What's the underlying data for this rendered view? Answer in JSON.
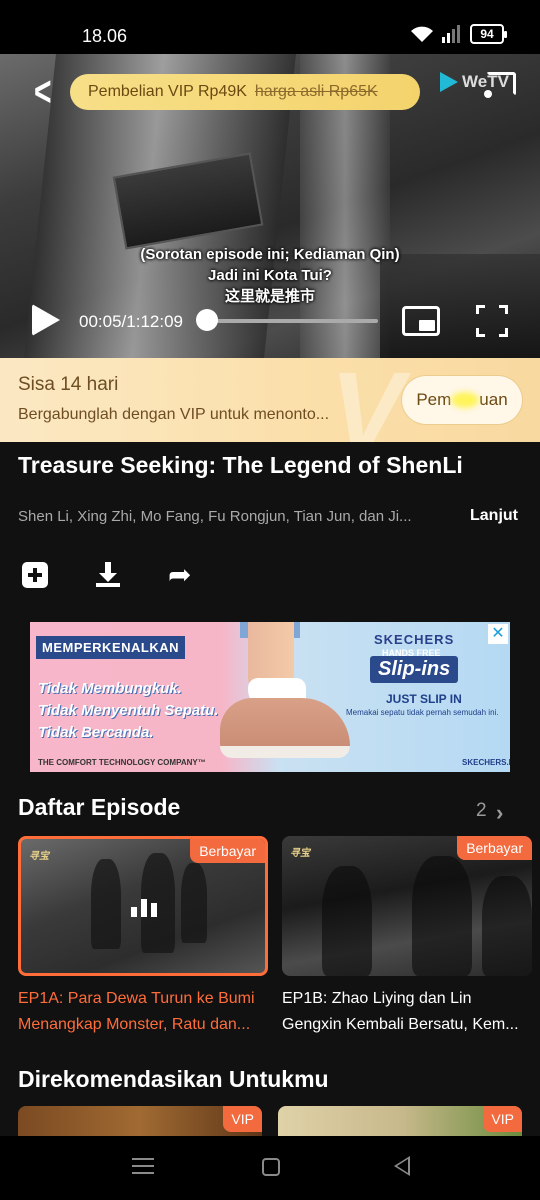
{
  "status_bar": {
    "time": "18.06",
    "battery": "94"
  },
  "player": {
    "promo_price": "Pembelian VIP Rp49K",
    "promo_original": "harga asli Rp65K",
    "brand": "WeTV",
    "subtitles": [
      "(Sorotan episode ini; Kediaman Qin)",
      "Jadi ini Kota Tui?",
      "这里就是推市"
    ],
    "time": "00:05/1:12:09",
    "progress": 0.001
  },
  "vip_banner": {
    "days_left": "Sisa 14 hari",
    "description": "Bergabunglah dengan VIP untuk menonto...",
    "button_prefix": "Pem",
    "button_suffix": "uan"
  },
  "show": {
    "title": "Treasure Seeking: The Legend of ShenLi",
    "cast": "Shen Li, Xing Zhi, Mo Fang, Fu Rongjun, Tian Jun, dan Ji...",
    "more_label": "Lanjut"
  },
  "ad": {
    "badge": "MEMPERKENALKAN",
    "lines": [
      "Tidak Membungkuk.",
      "Tidak Menyentuh Sepatu.",
      "Tidak Bercanda."
    ],
    "footer": "THE COMFORT TECHNOLOGY COMPANY™",
    "brand": "SKECHERS",
    "hands_free": "HANDS FREE",
    "product": "Slip-ins",
    "tagline": "JUST SLIP IN",
    "subline": "Memakai sepatu tidak pernah semudah ini.",
    "url": "SKECHERS.ID",
    "close": "✕"
  },
  "episodes": {
    "title": "Daftar Episode",
    "page_count": "2",
    "items": [
      {
        "badge": "Berbayar",
        "caption_line1": "EP1A: Para Dewa Turun ke Bumi",
        "caption_line2": "Menangkap Monster, Ratu dan...",
        "active": true
      },
      {
        "badge": "Berbayar",
        "caption_line1": "EP1B: Zhao Liying dan Lin",
        "caption_line2": "Gengxin Kembali Bersatu, Kem...",
        "active": false
      }
    ]
  },
  "recommended": {
    "title": "Direkomendasikan Untukmu",
    "items": [
      {
        "badge": "VIP"
      },
      {
        "badge": "VIP"
      }
    ]
  },
  "colors": {
    "accent": "#f26a3d",
    "vip_gold": "#f4d36c",
    "background": "#111111"
  }
}
